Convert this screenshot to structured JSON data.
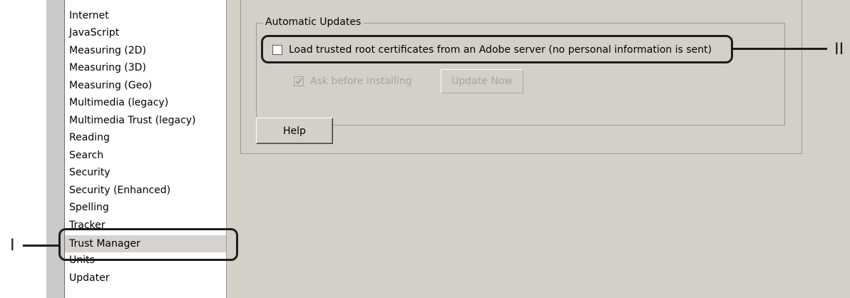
{
  "category_list": {
    "items": [
      {
        "label": "Internet"
      },
      {
        "label": "JavaScript"
      },
      {
        "label": "Measuring (2D)"
      },
      {
        "label": "Measuring (3D)"
      },
      {
        "label": "Measuring (Geo)"
      },
      {
        "label": "Multimedia (legacy)"
      },
      {
        "label": "Multimedia Trust (legacy)"
      },
      {
        "label": "Reading"
      },
      {
        "label": "Search"
      },
      {
        "label": "Security"
      },
      {
        "label": "Security (Enhanced)"
      },
      {
        "label": "Spelling"
      },
      {
        "label": "Tracker"
      },
      {
        "label": "Trust Manager",
        "selected": true
      },
      {
        "label": "Units"
      },
      {
        "label": "Updater"
      }
    ]
  },
  "automatic_updates": {
    "legend": "Automatic Updates",
    "load_certs_label": "Load trusted root certificates from an Adobe server (no personal information is sent)",
    "load_certs_checked": false,
    "ask_before_installing_label": "Ask before installing",
    "ask_before_installing_checked": true,
    "update_now_label": "Update Now"
  },
  "help_button_label": "Help",
  "callouts": {
    "one": "I",
    "two": "II"
  }
}
